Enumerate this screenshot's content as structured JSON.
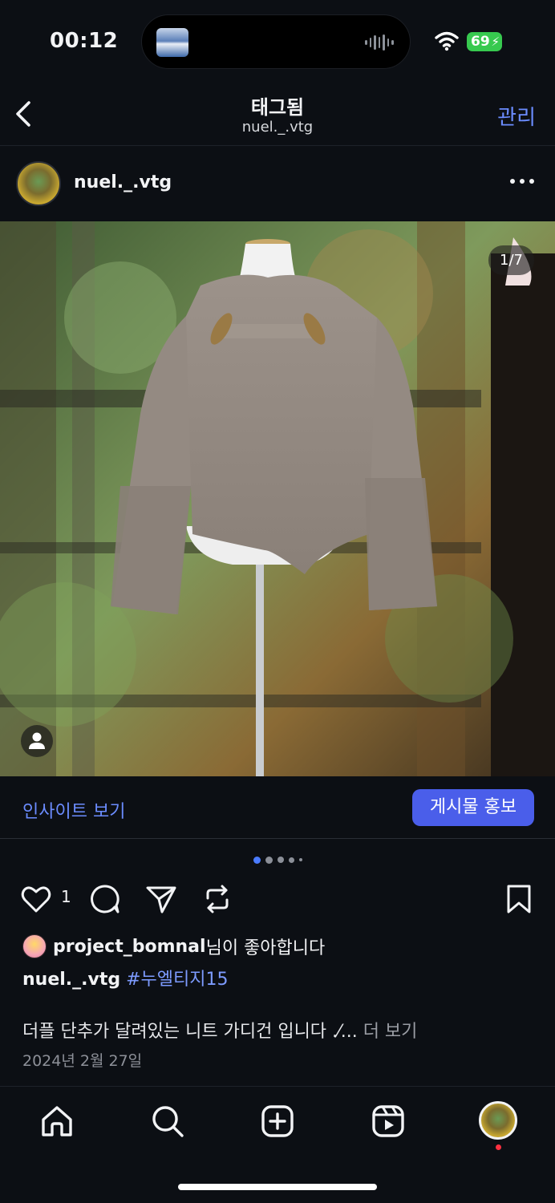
{
  "status_bar": {
    "time": "00:12",
    "battery": "69"
  },
  "header": {
    "title": "태그됨",
    "subtitle": "nuel._.vtg",
    "manage_label": "관리"
  },
  "post": {
    "username": "nuel._.vtg",
    "image_counter": "1/7",
    "insights_label": "인사이트 보기",
    "promote_label": "게시물 홍보",
    "like_count": "1",
    "liked_by_user": "project_bomnal",
    "liked_by_suffix": "님이 좋아합니다",
    "caption_user": "nuel._.vtg",
    "hashtag": "#누엘티지15",
    "description": "더플 단추가 달려있는 니트 가디건 입니다 .⁄...",
    "more_label": "더 보기",
    "date": "2024년 2월 27일"
  },
  "colors": {
    "accent": "#6b8cff",
    "promote_bg": "#4a5eea",
    "background": "#0c0f14"
  }
}
